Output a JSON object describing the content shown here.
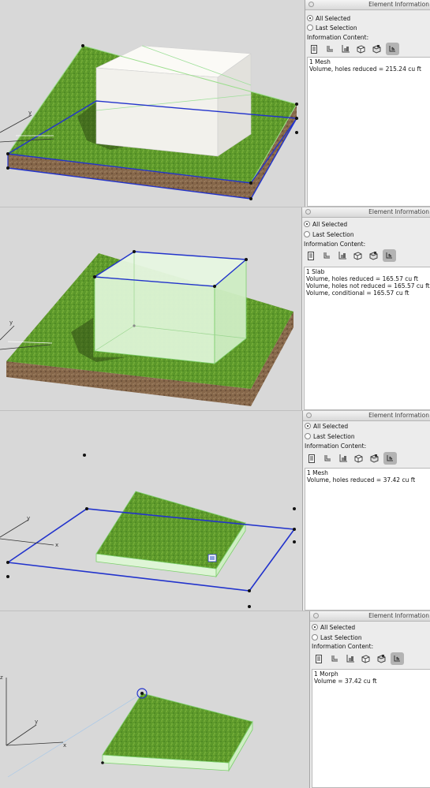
{
  "colors": {
    "grass": "#5f9a2a",
    "soil": "#7a5a3c",
    "selection": "#2233cc",
    "highlight_fill": "#e6f7e0",
    "box": "#f4f3ee"
  },
  "panels": [
    {
      "title": "Element Information",
      "options": [
        {
          "label": "All Selected",
          "checked": true
        },
        {
          "label": "Last Selection",
          "checked": false
        }
      ],
      "content_label": "Information Content:",
      "icons": [
        "document-icon",
        "bracket-icon",
        "axis-icon",
        "cube-icon",
        "flag-cube-icon",
        "hand-cube-icon"
      ],
      "selected_icon": 5,
      "lines": [
        "1 Mesh",
        "Volume, holes reduced = 215.24 cu ft"
      ]
    },
    {
      "title": "Element Information",
      "options": [
        {
          "label": "All Selected",
          "checked": true
        },
        {
          "label": "Last Selection",
          "checked": false
        }
      ],
      "content_label": "Information Content:",
      "icons": [
        "document-icon",
        "bracket-icon",
        "axis-icon",
        "cube-icon",
        "flag-cube-icon",
        "hand-cube-icon"
      ],
      "selected_icon": 5,
      "lines": [
        "1 Slab",
        "Volume, holes reduced = 165.57 cu ft",
        "Volume, holes not reduced = 165.57 cu ft",
        "Volume, conditional = 165.57 cu ft"
      ]
    },
    {
      "title": "Element Information",
      "options": [
        {
          "label": "All Selected",
          "checked": true
        },
        {
          "label": "Last Selection",
          "checked": false
        }
      ],
      "content_label": "Information Content:",
      "icons": [
        "document-icon",
        "bracket-icon",
        "axis-icon",
        "cube-icon",
        "flag-cube-icon",
        "hand-cube-icon"
      ],
      "selected_icon": 5,
      "lines": [
        "1 Mesh",
        "Volume, holes reduced = 37.42 cu ft"
      ]
    },
    {
      "title": "Element Information",
      "options": [
        {
          "label": "All Selected",
          "checked": true
        },
        {
          "label": "Last Selection",
          "checked": false
        }
      ],
      "content_label": "Information Content:",
      "icons": [
        "document-icon",
        "bracket-icon",
        "axis-icon",
        "cube-icon",
        "flag-cube-icon",
        "hand-cube-icon"
      ],
      "selected_icon": 5,
      "lines": [
        "1 Morph",
        "Volume = 37.42 cu ft"
      ]
    }
  ],
  "axes": {
    "x": "x",
    "y": "y",
    "z": "z"
  }
}
